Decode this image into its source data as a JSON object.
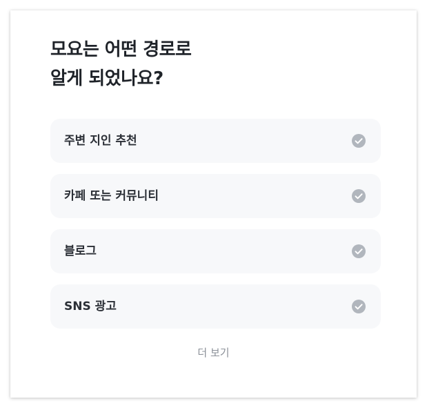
{
  "title": {
    "line1": "모요는 어떤 경로로",
    "line2": "알게 되었나요?"
  },
  "options": [
    {
      "label": "주변 지인 추천",
      "icon": "check-circle-icon"
    },
    {
      "label": "카페 또는 커뮤니티",
      "icon": "check-circle-icon"
    },
    {
      "label": "블로그",
      "icon": "check-circle-icon"
    },
    {
      "label": "SNS 광고",
      "icon": "check-circle-icon"
    }
  ],
  "more_label": "더 보기",
  "colors": {
    "option_bg": "#f7f8fa",
    "check_icon": "#b1b6bd",
    "text": "#1f2329",
    "more_text": "#8b9098"
  }
}
